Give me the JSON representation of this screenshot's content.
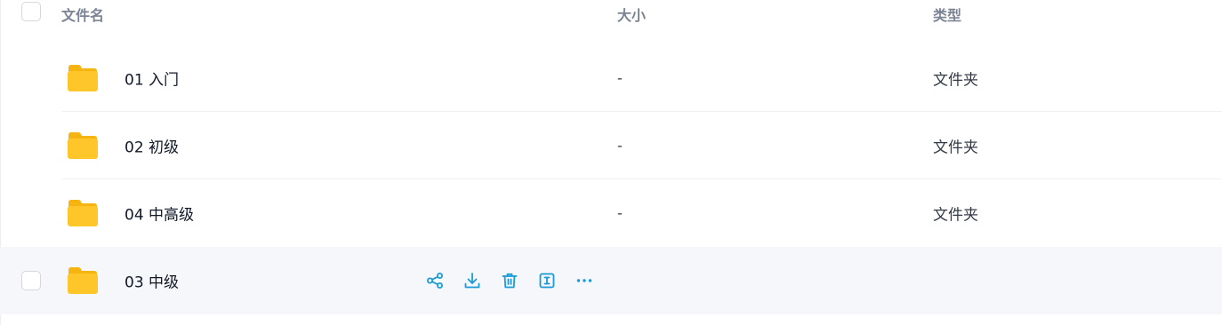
{
  "header": {
    "col_name": "文件名",
    "col_size": "大小",
    "col_type": "类型"
  },
  "rows": [
    {
      "name": "01 入门",
      "size": "-",
      "type": "文件夹"
    },
    {
      "name": "02 初级",
      "size": "-",
      "type": "文件夹"
    },
    {
      "name": "04 中高级",
      "size": "-",
      "type": "文件夹"
    },
    {
      "name": "03 中级"
    }
  ],
  "colors": {
    "accent": "#1a9bd7",
    "folder": "#ffc629",
    "hover_row": "#f6f7fa",
    "header_text": "#7b8494"
  },
  "icons": {
    "row_actions": [
      "share-icon",
      "download-icon",
      "delete-icon",
      "rename-icon",
      "more-icon"
    ]
  }
}
